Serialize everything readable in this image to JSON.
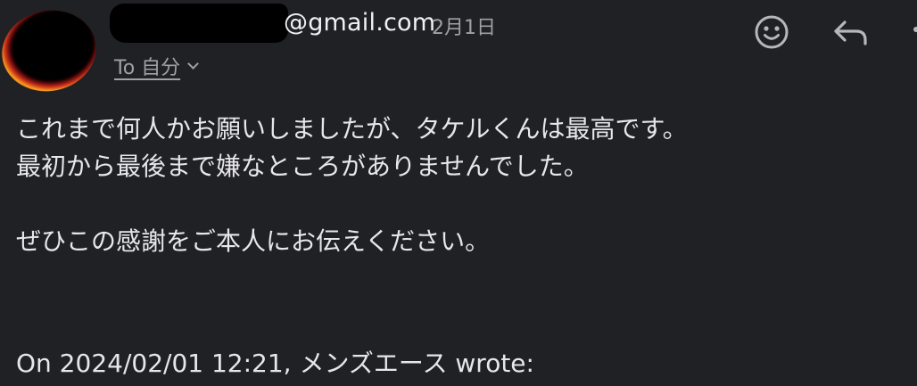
{
  "header": {
    "sender_domain": "@gmail.com",
    "date": "2月1日",
    "recipient_label": "To 自分"
  },
  "icons": {
    "avatar": "avatar",
    "emoji": "smiley-face-icon",
    "reply": "reply-arrow-icon",
    "more": "more-vert-icon",
    "expand": "chevron-down-icon"
  },
  "message": {
    "lines": [
      "これまで何人かお願いしましたが、タケルくんは最高です。",
      "最初から最後まで嫌なところがありませんでした。",
      "",
      "ぜひこの感謝をご本人にお伝えください。"
    ],
    "quote_header": "On 2024/02/01 12:21, メンズエース wrote:"
  },
  "colors": {
    "background": "#202125",
    "text": "#e7e7ea",
    "muted": "#9fa1a8"
  }
}
